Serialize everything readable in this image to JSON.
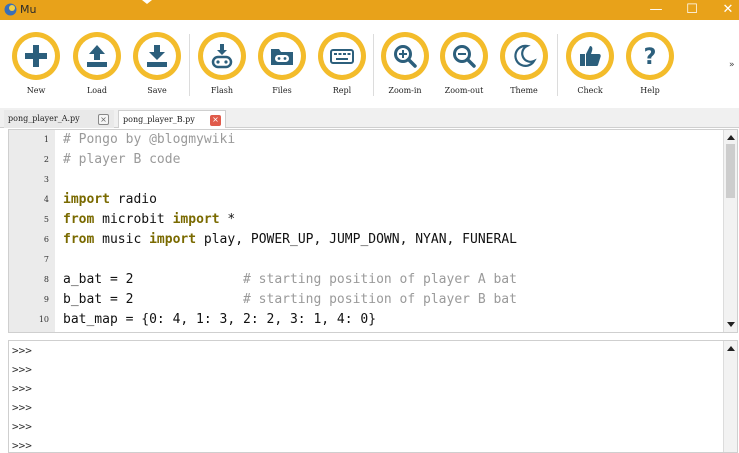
{
  "window": {
    "title": "Mu",
    "minimize_glyph": "—",
    "maximize_glyph": "☐",
    "close_glyph": "✕"
  },
  "toolbar": {
    "buttons": [
      {
        "label": "New",
        "icon": "plus-icon"
      },
      {
        "label": "Load",
        "icon": "upload-icon"
      },
      {
        "label": "Save",
        "icon": "download-icon"
      },
      {
        "label": "Flash",
        "icon": "flash-microbit-icon"
      },
      {
        "label": "Files",
        "icon": "files-icon"
      },
      {
        "label": "Repl",
        "icon": "keyboard-icon"
      },
      {
        "label": "Zoom-in",
        "icon": "zoom-in-icon"
      },
      {
        "label": "Zoom-out",
        "icon": "zoom-out-icon"
      },
      {
        "label": "Theme",
        "icon": "moon-icon"
      },
      {
        "label": "Check",
        "icon": "thumbs-up-icon"
      },
      {
        "label": "Help",
        "icon": "question-icon"
      }
    ],
    "more": "»"
  },
  "tabs": [
    {
      "label": "pong_player_A.py",
      "close": "×",
      "active": false
    },
    {
      "label": "pong_player_B.py",
      "close": "×",
      "active": true
    }
  ],
  "editor": {
    "lines": [
      {
        "n": "1",
        "code": "# Pongo by @blogmywiki"
      },
      {
        "n": "2",
        "code": "# player B code"
      },
      {
        "n": "3",
        "code": ""
      },
      {
        "n": "4",
        "code": "import radio"
      },
      {
        "n": "5",
        "code": "from microbit import *"
      },
      {
        "n": "6",
        "code": "from music import play, POWER_UP, JUMP_DOWN, NYAN, FUNERAL"
      },
      {
        "n": "7",
        "code": ""
      },
      {
        "n": "8",
        "code": "a_bat = 2              # starting position of player A bat"
      },
      {
        "n": "9",
        "code": "b_bat = 2              # starting position of player B bat"
      },
      {
        "n": "10",
        "code": "bat_map = {0: 4, 1: 3, 2: 2, 3: 1, 4: 0}"
      }
    ]
  },
  "repl": {
    "prompts": [
      ">>>",
      ">>>",
      ">>>",
      ">>>",
      ">>>",
      ">>>"
    ]
  },
  "colors": {
    "titlebar": "#e8a21a",
    "button_ring": "#f3bc2b",
    "icon": "#2c5f7c",
    "tab_close_active": "#e05b4b"
  }
}
